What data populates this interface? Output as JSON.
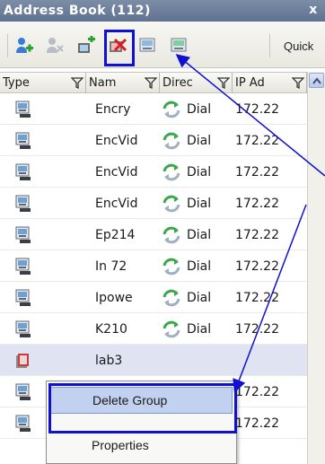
{
  "window": {
    "title": "Address Book (112)",
    "close_label": "x"
  },
  "toolbar": {
    "buttons": [
      {
        "icon": "add-user-icon"
      },
      {
        "icon": "remove-user-icon"
      },
      {
        "icon": "add-group-icon"
      },
      {
        "icon": "delete-group-icon"
      },
      {
        "icon": "properties-icon"
      },
      {
        "icon": "properties-alt-icon"
      }
    ],
    "quick_label": "Quick"
  },
  "columns": [
    {
      "label": "Type"
    },
    {
      "label": "Nam"
    },
    {
      "label": "Direc"
    },
    {
      "label": "IP Ad"
    }
  ],
  "rows": [
    {
      "type_icon": "endpoint-icon",
      "name": "Encry",
      "direction": "Dial",
      "ip": "172.22"
    },
    {
      "type_icon": "endpoint-icon",
      "name": "EncVid",
      "direction": "Dial",
      "ip": "172.22"
    },
    {
      "type_icon": "endpoint-icon",
      "name": "EncVid",
      "direction": "Dial",
      "ip": "172.22"
    },
    {
      "type_icon": "endpoint-icon",
      "name": "EncVid",
      "direction": "Dial",
      "ip": "172.22"
    },
    {
      "type_icon": "endpoint-icon",
      "name": "Ep214",
      "direction": "Dial",
      "ip": "172.22"
    },
    {
      "type_icon": "endpoint-icon",
      "name": "In 72",
      "direction": "Dial",
      "ip": "172.22"
    },
    {
      "type_icon": "endpoint-icon",
      "name": "Ipowe",
      "direction": "Dial",
      "ip": "172.22"
    },
    {
      "type_icon": "endpoint-icon",
      "name": "K210",
      "direction": "Dial",
      "ip": "172.22"
    },
    {
      "type_icon": "group-icon",
      "name": "lab3",
      "direction": "",
      "ip": ""
    },
    {
      "type_icon": "endpoint-icon",
      "name": "",
      "direction": "",
      "ip": "172.22"
    },
    {
      "type_icon": "endpoint-icon",
      "name": "",
      "direction": "",
      "ip": "172.22"
    }
  ],
  "context_menu": {
    "items": [
      {
        "label": "Delete Group"
      },
      {
        "label": "Properties"
      }
    ]
  },
  "colors": {
    "accent": "#1010d0",
    "title_bar": "#6b7e9b",
    "selection": "#dfe3f2",
    "menu_hover": "#c2d1ef"
  }
}
